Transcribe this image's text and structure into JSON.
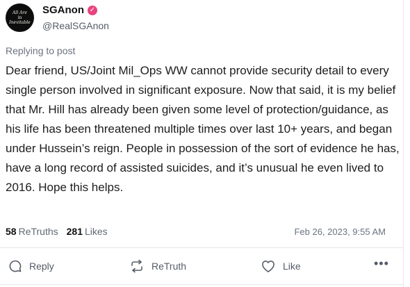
{
  "author": {
    "display_name": "SGAnon",
    "handle": "@RealSGAnon",
    "verified": true,
    "avatar_text_line1": "All Are",
    "avatar_text_line2": "in",
    "avatar_text_line3": "Inevitable"
  },
  "replying_label": "Replying to post",
  "post_text": "Dear friend, US/Joint Mil_Ops WW cannot provide security detail to every single person involved in significant exposure. Now that said, it is my belief that Mr. Hill has already been given some level of protection/guidance, as his life has been threatened multiple times over last 10+ years, and began under Hussein’s reign. People in possession of the sort of evidence he has, have a long record of assisted suicides, and it’s unusual he even lived to 2016. Hope this helps.",
  "stats": {
    "retruths_count": "58",
    "retruths_label": "ReTruths",
    "likes_count": "281",
    "likes_label": "Likes"
  },
  "timestamp": "Feb 26, 2023, 9:55 AM",
  "actions": {
    "reply_label": "Reply",
    "retruth_label": "ReTruth",
    "like_label": "Like",
    "more_label": "•••"
  },
  "colors": {
    "verified_badge": "#e8437f",
    "muted_text": "#6b7280",
    "divider": "#e7e7ea"
  }
}
